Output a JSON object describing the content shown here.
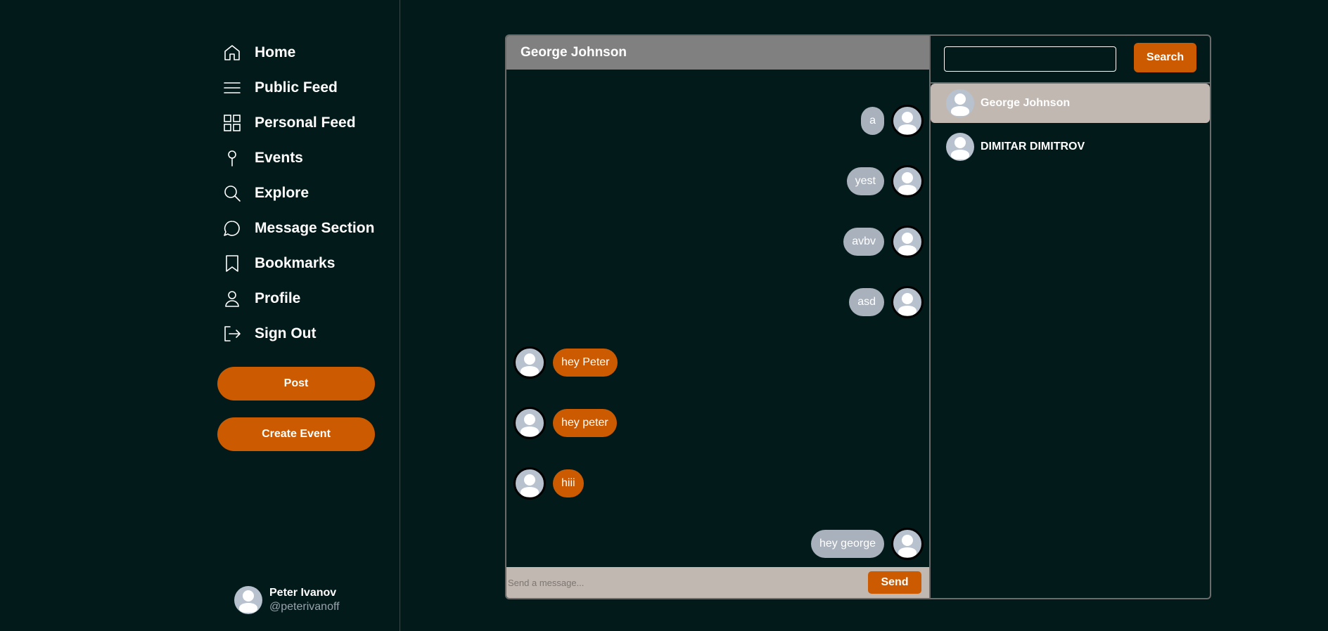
{
  "sidebar": {
    "items": [
      {
        "label": "Home",
        "icon": "home-icon"
      },
      {
        "label": "Public Feed",
        "icon": "menu-icon"
      },
      {
        "label": "Personal Feed",
        "icon": "grid-icon"
      },
      {
        "label": "Events",
        "icon": "pin-icon"
      },
      {
        "label": "Explore",
        "icon": "search-icon"
      },
      {
        "label": "Message Section",
        "icon": "chat-bubble-icon"
      },
      {
        "label": "Bookmarks",
        "icon": "bookmark-icon"
      },
      {
        "label": "Profile",
        "icon": "user-icon"
      },
      {
        "label": "Sign Out",
        "icon": "sign-out-icon"
      }
    ],
    "post_label": "Post",
    "create_event_label": "Create Event",
    "user": {
      "name": "Peter Ivanov",
      "handle": "@peterivanoff"
    }
  },
  "chat": {
    "header_name": "George Johnson",
    "messages": [
      {
        "side": "right",
        "text": "a"
      },
      {
        "side": "right",
        "text": "yest"
      },
      {
        "side": "right",
        "text": "avbv"
      },
      {
        "side": "right",
        "text": "asd"
      },
      {
        "side": "left",
        "text": "hey Peter"
      },
      {
        "side": "left",
        "text": "hey peter"
      },
      {
        "side": "left",
        "text": "hiii"
      },
      {
        "side": "right",
        "text": "hey george"
      }
    ],
    "composer": {
      "placeholder": "Send a message...",
      "send_label": "Send"
    }
  },
  "contacts": {
    "search_value": "",
    "search_label": "Search",
    "list": [
      {
        "name": "George Johnson",
        "active": true
      },
      {
        "name": "DIMITAR DIMITROV",
        "active": false
      }
    ]
  },
  "colors": {
    "background": "#021b1a",
    "accent": "#cc5a00",
    "received_bubble": "#a9b1bc",
    "header": "#808080",
    "active_contact": "#c2b8b2"
  }
}
